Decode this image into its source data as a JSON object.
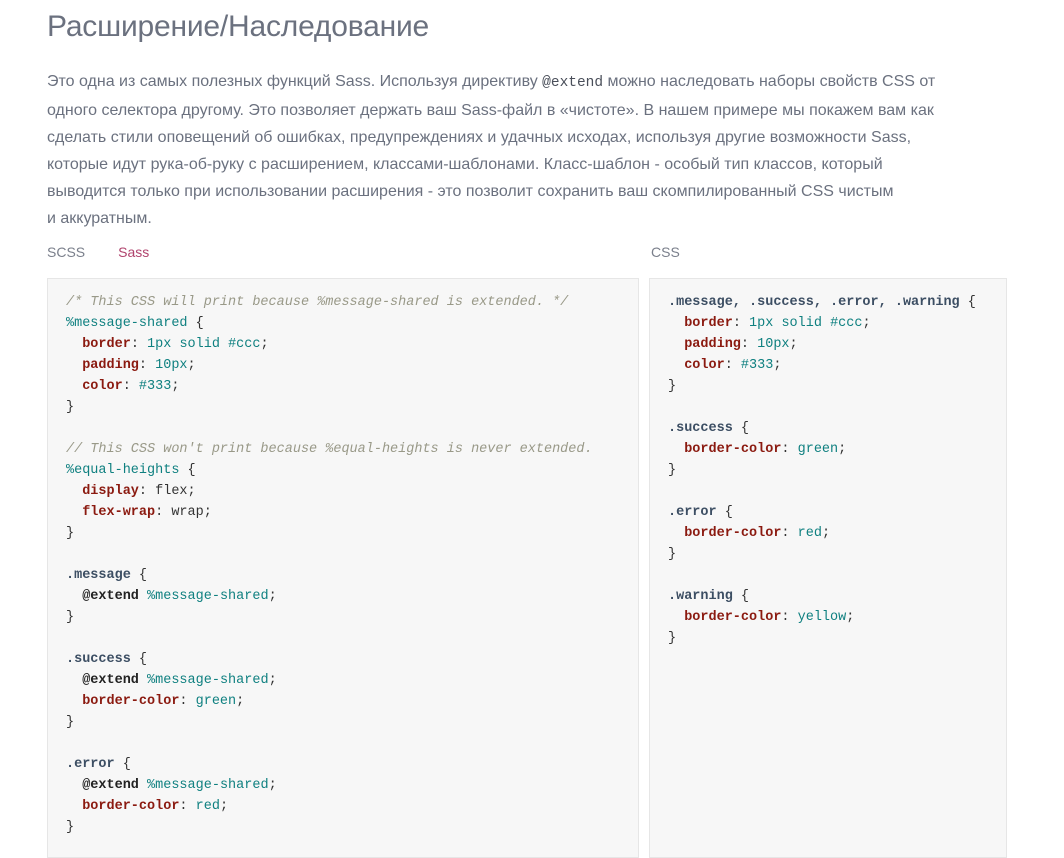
{
  "heading": "Расширение/Наследование",
  "intro": {
    "l1a": "Это одна из самых полезных функций Sass. Используя директиву ",
    "l1code": "@extend",
    "l1b": " можно наследовать наборы свойств CSS от",
    "l2": "одного селектора другому. Это позволяет держать ваш Sass-файл в «чистоте». В нашем примере мы покажем вам как",
    "l3": "сделать стили оповещений об ошибках, предупреждениях и удачных исходах, используя другие возможности Sass,",
    "l4": "которые идут рука-об-руку с расширением, классами-шаблонами. Класс-шаблон - особый тип классов, который",
    "l5": "выводится только при использовании расширения - это позволит сохранить ваш скомпилированный CSS чистым",
    "l6": "и аккуратным."
  },
  "tabs": {
    "scss": "SCSS",
    "sass": "Sass",
    "css": "CSS"
  },
  "scss_code": [
    [
      [
        "cm",
        "/* This CSS will print because %message-shared is extended. */"
      ]
    ],
    [
      [
        "ph",
        "%message-shared"
      ],
      [
        "pl",
        " {"
      ]
    ],
    [
      [
        "pl",
        "  "
      ],
      [
        "pr",
        "border"
      ],
      [
        "pl",
        ": "
      ],
      [
        "nu",
        "1px"
      ],
      [
        "pl",
        " "
      ],
      [
        "va",
        "solid"
      ],
      [
        "pl",
        " "
      ],
      [
        "va",
        "#ccc"
      ],
      [
        "pl",
        ";"
      ]
    ],
    [
      [
        "pl",
        "  "
      ],
      [
        "pr",
        "padding"
      ],
      [
        "pl",
        ": "
      ],
      [
        "nu",
        "10px"
      ],
      [
        "pl",
        ";"
      ]
    ],
    [
      [
        "pl",
        "  "
      ],
      [
        "pr",
        "color"
      ],
      [
        "pl",
        ": "
      ],
      [
        "va",
        "#333"
      ],
      [
        "pl",
        ";"
      ]
    ],
    [
      [
        "pl",
        "}"
      ]
    ],
    [],
    [
      [
        "cm",
        "// This CSS won't print because %equal-heights is never extended."
      ]
    ],
    [
      [
        "ph",
        "%equal-heights"
      ],
      [
        "pl",
        " {"
      ]
    ],
    [
      [
        "pl",
        "  "
      ],
      [
        "pr",
        "display"
      ],
      [
        "pl",
        ": flex;"
      ]
    ],
    [
      [
        "pl",
        "  "
      ],
      [
        "pr",
        "flex-wrap"
      ],
      [
        "pl",
        ": wrap;"
      ]
    ],
    [
      [
        "pl",
        "}"
      ]
    ],
    [],
    [
      [
        "sel",
        ".message"
      ],
      [
        "pl",
        " {"
      ]
    ],
    [
      [
        "pl",
        "  "
      ],
      [
        "at",
        "@extend"
      ],
      [
        "pl",
        " "
      ],
      [
        "ph",
        "%message-shared"
      ],
      [
        "pl",
        ";"
      ]
    ],
    [
      [
        "pl",
        "}"
      ]
    ],
    [],
    [
      [
        "sel",
        ".success"
      ],
      [
        "pl",
        " {"
      ]
    ],
    [
      [
        "pl",
        "  "
      ],
      [
        "at",
        "@extend"
      ],
      [
        "pl",
        " "
      ],
      [
        "ph",
        "%message-shared"
      ],
      [
        "pl",
        ";"
      ]
    ],
    [
      [
        "pl",
        "  "
      ],
      [
        "pr",
        "border-color"
      ],
      [
        "pl",
        ": "
      ],
      [
        "va",
        "green"
      ],
      [
        "pl",
        ";"
      ]
    ],
    [
      [
        "pl",
        "}"
      ]
    ],
    [],
    [
      [
        "sel",
        ".error"
      ],
      [
        "pl",
        " {"
      ]
    ],
    [
      [
        "pl",
        "  "
      ],
      [
        "at",
        "@extend"
      ],
      [
        "pl",
        " "
      ],
      [
        "ph",
        "%message-shared"
      ],
      [
        "pl",
        ";"
      ]
    ],
    [
      [
        "pl",
        "  "
      ],
      [
        "pr",
        "border-color"
      ],
      [
        "pl",
        ": "
      ],
      [
        "va",
        "red"
      ],
      [
        "pl",
        ";"
      ]
    ],
    [
      [
        "pl",
        "}"
      ]
    ]
  ],
  "css_code": [
    [
      [
        "sel",
        ".message, .success, .error, .warning"
      ],
      [
        "pl",
        " {"
      ]
    ],
    [
      [
        "pl",
        "  "
      ],
      [
        "pr",
        "border"
      ],
      [
        "pl",
        ": "
      ],
      [
        "nu",
        "1px"
      ],
      [
        "pl",
        " "
      ],
      [
        "va",
        "solid"
      ],
      [
        "pl",
        " "
      ],
      [
        "va",
        "#ccc"
      ],
      [
        "pl",
        ";"
      ]
    ],
    [
      [
        "pl",
        "  "
      ],
      [
        "pr",
        "padding"
      ],
      [
        "pl",
        ": "
      ],
      [
        "nu",
        "10px"
      ],
      [
        "pl",
        ";"
      ]
    ],
    [
      [
        "pl",
        "  "
      ],
      [
        "pr",
        "color"
      ],
      [
        "pl",
        ": "
      ],
      [
        "va",
        "#333"
      ],
      [
        "pl",
        ";"
      ]
    ],
    [
      [
        "pl",
        "}"
      ]
    ],
    [],
    [
      [
        "sel",
        ".success"
      ],
      [
        "pl",
        " {"
      ]
    ],
    [
      [
        "pl",
        "  "
      ],
      [
        "pr",
        "border-color"
      ],
      [
        "pl",
        ": "
      ],
      [
        "va",
        "green"
      ],
      [
        "pl",
        ";"
      ]
    ],
    [
      [
        "pl",
        "}"
      ]
    ],
    [],
    [
      [
        "sel",
        ".error"
      ],
      [
        "pl",
        " {"
      ]
    ],
    [
      [
        "pl",
        "  "
      ],
      [
        "pr",
        "border-color"
      ],
      [
        "pl",
        ": "
      ],
      [
        "va",
        "red"
      ],
      [
        "pl",
        ";"
      ]
    ],
    [
      [
        "pl",
        "}"
      ]
    ],
    [],
    [
      [
        "sel",
        ".warning"
      ],
      [
        "pl",
        " {"
      ]
    ],
    [
      [
        "pl",
        "  "
      ],
      [
        "pr",
        "border-color"
      ],
      [
        "pl",
        ": "
      ],
      [
        "va",
        "yellow"
      ],
      [
        "pl",
        ";"
      ]
    ],
    [
      [
        "pl",
        "}"
      ]
    ]
  ]
}
